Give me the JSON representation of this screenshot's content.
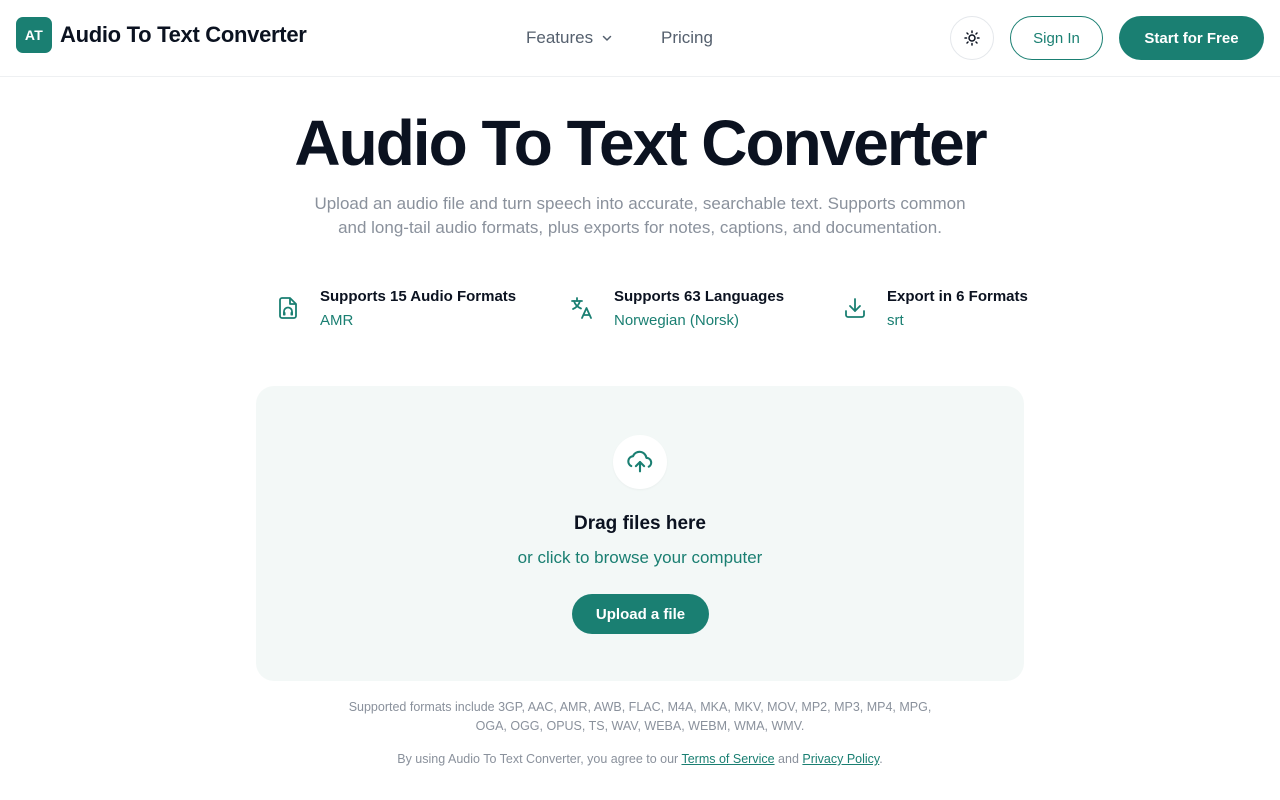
{
  "header": {
    "logo_text": "AT",
    "brand": "Audio To Text Converter",
    "nav": {
      "features_label": "Features",
      "pricing_label": "Pricing"
    },
    "sign_in_label": "Sign In",
    "start_label": "Start for Free",
    "theme_icon": "sun-icon"
  },
  "hero": {
    "title": "Audio To Text Converter",
    "subtitle": "Upload an audio file and turn speech into accurate, searchable text. Supports common and long-tail audio formats, plus exports for notes, captions, and documentation."
  },
  "features": [
    {
      "icon": "audio-file-icon",
      "title": "Supports 15 Audio Formats",
      "value": "AMR"
    },
    {
      "icon": "translate-icon",
      "title": "Supports 63 Languages",
      "value": "Norwegian (Norsk)"
    },
    {
      "icon": "download-icon",
      "title": "Export in 6 Formats",
      "value": "srt"
    }
  ],
  "dropzone": {
    "title": "Drag files here",
    "subtitle": "or click to browse your computer",
    "button_label": "Upload a file",
    "icon": "cloud-upload-icon"
  },
  "notes": {
    "formats": "Supported formats include 3GP, AAC, AMR, AWB, FLAC, M4A, MKA, MKV, MOV, MP2, MP3, MP4, MPG, OGA, OGG, OPUS, TS, WAV, WEBA, WEBM, WMA, WMV.",
    "legal_prefix": "By using Audio To Text Converter, you agree to our",
    "terms_label": "Terms of Service",
    "and_text": "and",
    "privacy_label": "Privacy Policy",
    "legal_suffix": "."
  },
  "colors": {
    "accent": "#1a7f72",
    "text_dark": "#0b1220",
    "text_muted": "#8a919c",
    "dropzone_bg": "#f3f8f7"
  }
}
